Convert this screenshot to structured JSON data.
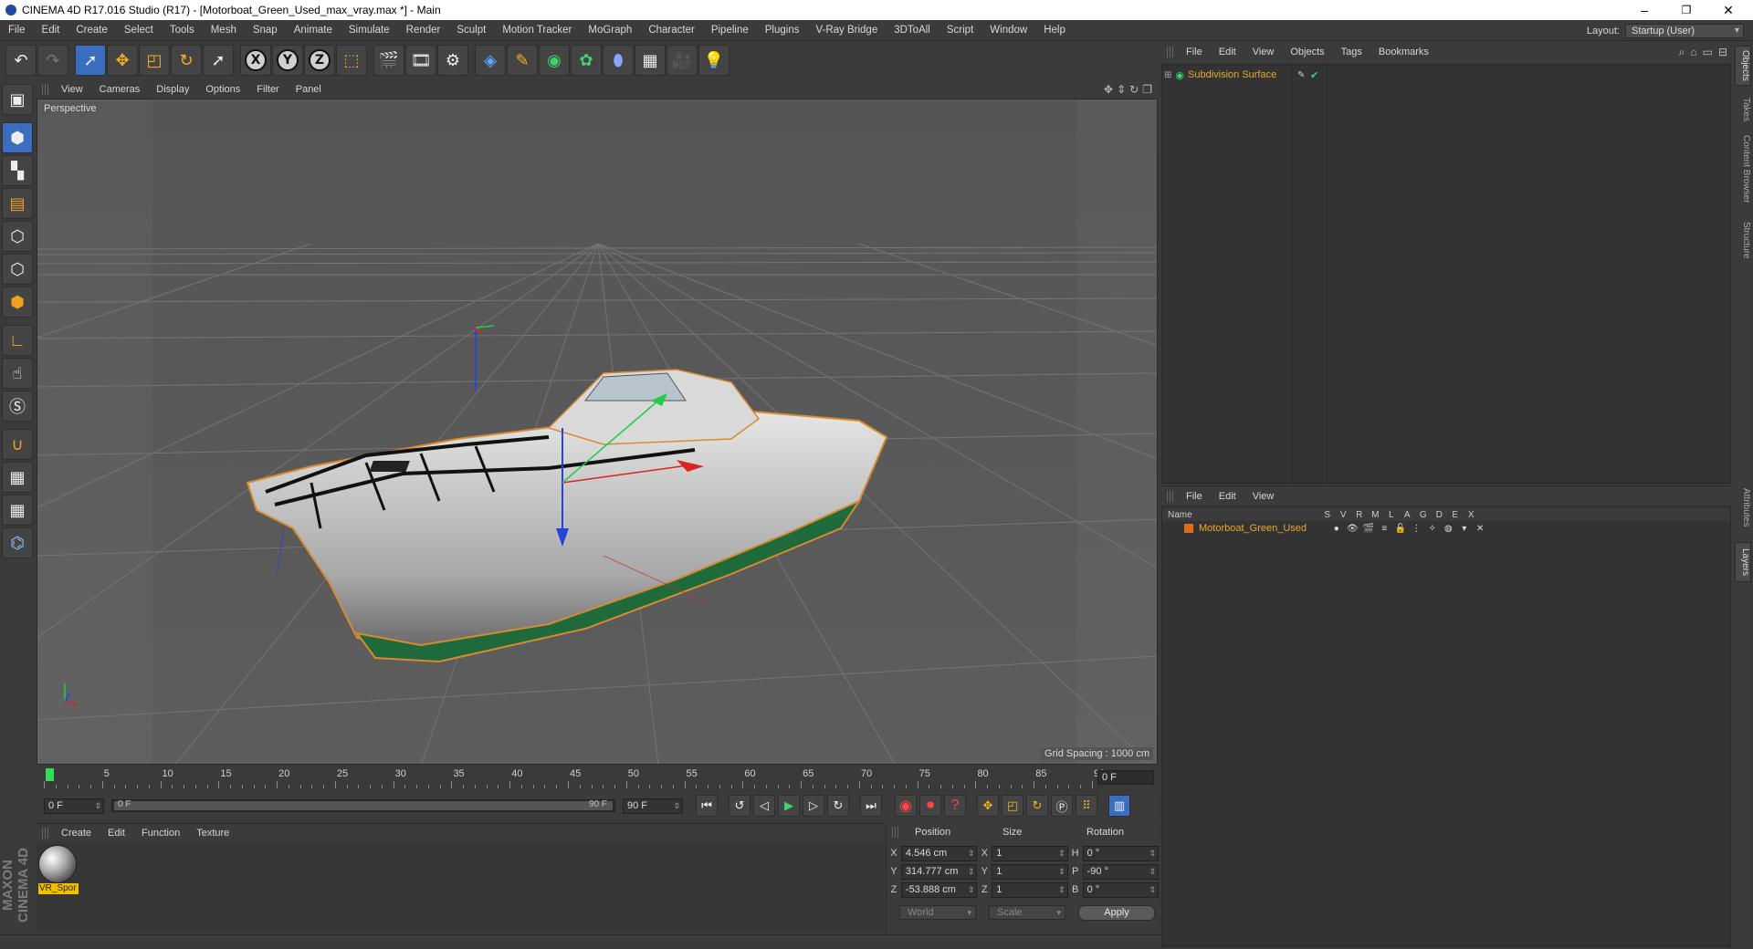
{
  "title": {
    "text": "CINEMA 4D R17.016 Studio (R17) - [Motorboat_Green_Used_max_vray.max *] - Main",
    "minimize": "–",
    "maximize": "❐",
    "close": "✕"
  },
  "menu": [
    "File",
    "Edit",
    "Create",
    "Select",
    "Tools",
    "Mesh",
    "Snap",
    "Animate",
    "Simulate",
    "Render",
    "Sculpt",
    "Motion Tracker",
    "MoGraph",
    "Character",
    "Pipeline",
    "Plugins",
    "V-Ray Bridge",
    "3DToAll",
    "Script",
    "Window",
    "Help"
  ],
  "layout": {
    "label": "Layout:",
    "value": "Startup (User)"
  },
  "toolbar": {
    "x": "X",
    "y": "Y",
    "z": "Z"
  },
  "viewport": {
    "menu": [
      "View",
      "Cameras",
      "Display",
      "Options",
      "Filter",
      "Panel"
    ],
    "label": "Perspective",
    "grid_spacing": "Grid Spacing : 1000 cm"
  },
  "timeline": {
    "ticks": [
      "0",
      "5",
      "10",
      "15",
      "20",
      "25",
      "30",
      "35",
      "40",
      "45",
      "50",
      "55",
      "60",
      "65",
      "70",
      "75",
      "80",
      "85",
      "90"
    ],
    "current": "0 F",
    "start": "0 F",
    "range_start": "0 F",
    "range_end": "90 F",
    "end": "90 F"
  },
  "material": {
    "menu": [
      "Create",
      "Edit",
      "Function",
      "Texture"
    ],
    "name": "VR_Spor"
  },
  "coordinates": {
    "headers": [
      "Position",
      "Size",
      "Rotation"
    ],
    "rows": [
      {
        "pos_axis": "X",
        "pos": "4.546 cm",
        "size_axis": "X",
        "size": "1",
        "rot_axis": "H",
        "rot": "0 °"
      },
      {
        "pos_axis": "Y",
        "pos": "314.777 cm",
        "size_axis": "Y",
        "size": "1",
        "rot_axis": "P",
        "rot": "-90 °"
      },
      {
        "pos_axis": "Z",
        "pos": "-53.888 cm",
        "size_axis": "Z",
        "size": "1",
        "rot_axis": "B",
        "rot": "0 °"
      }
    ],
    "world": "World",
    "scale": "Scale",
    "apply": "Apply"
  },
  "objects": {
    "menu": [
      "File",
      "Edit",
      "View",
      "Objects",
      "Tags",
      "Bookmarks"
    ],
    "item": "Subdivision Surface"
  },
  "layers": {
    "menu": [
      "File",
      "Edit",
      "View"
    ],
    "columns": [
      "Name",
      "S",
      "V",
      "R",
      "M",
      "L",
      "A",
      "G",
      "D",
      "E",
      "X"
    ],
    "item": "Motorboat_Green_Used"
  },
  "side_tabs": [
    "Objects",
    "Takes",
    "Content Browser",
    "Structure",
    "Attributes",
    "Layers"
  ],
  "maxon": "MAXON CINEMA 4D"
}
